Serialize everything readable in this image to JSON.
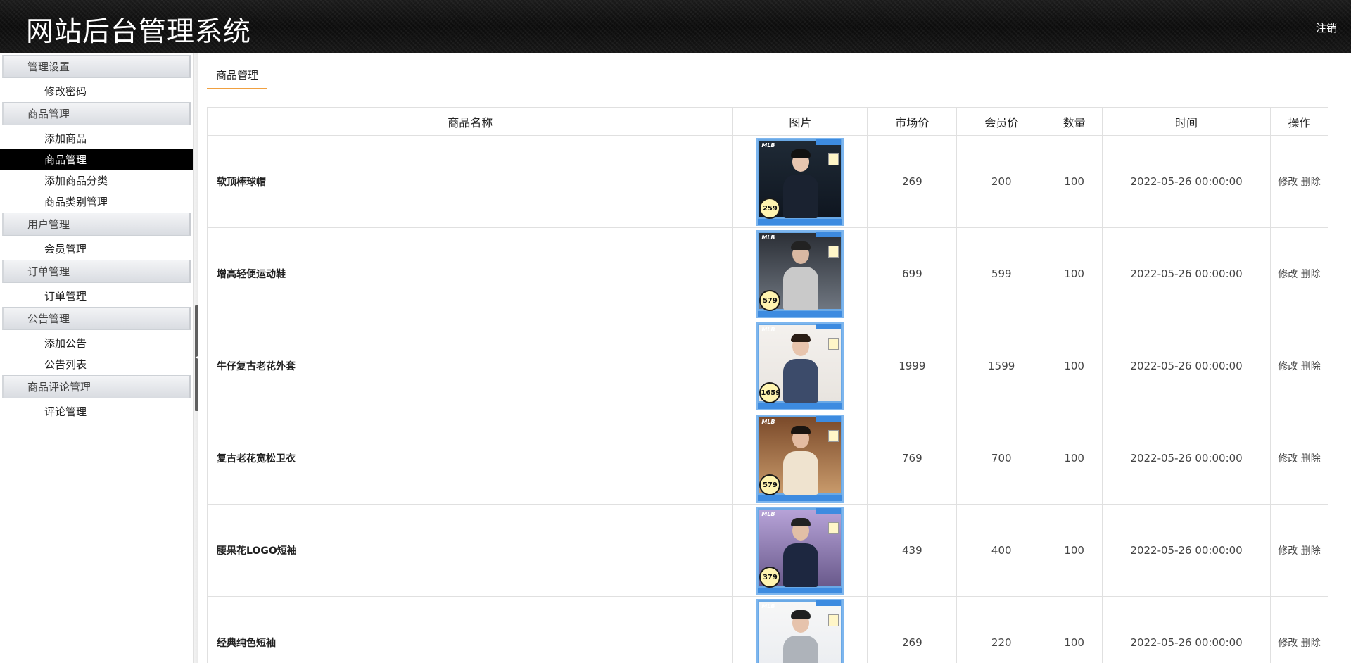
{
  "header": {
    "title": "网站后台管理系统",
    "logout": "注销"
  },
  "sidebar": {
    "groups": [
      {
        "title": "管理设置",
        "items": [
          "修改密码"
        ]
      },
      {
        "title": "商品管理",
        "items": [
          "添加商品",
          "商品管理",
          "添加商品分类",
          "商品类别管理"
        ]
      },
      {
        "title": "用户管理",
        "items": [
          "会员管理"
        ]
      },
      {
        "title": "订单管理",
        "items": [
          "订单管理"
        ]
      },
      {
        "title": "公告管理",
        "items": [
          "添加公告",
          "公告列表"
        ]
      },
      {
        "title": "商品评论管理",
        "items": [
          "评论管理"
        ]
      }
    ],
    "active_item": "商品管理"
  },
  "tab": {
    "label": "商品管理"
  },
  "table": {
    "columns": [
      "商品名称",
      "图片",
      "市场价",
      "会员价",
      "数量",
      "时间",
      "操作"
    ],
    "edit_label": "修改",
    "delete_label": "删除",
    "rows": [
      {
        "name": "软顶棒球帽",
        "market_price": "269",
        "member_price": "200",
        "quantity": "100",
        "time": "2022-05-26 00:00:00",
        "image": {
          "brand": "MLB",
          "badge": "259",
          "theme": "dark"
        }
      },
      {
        "name": "增高轻便运动鞋",
        "market_price": "699",
        "member_price": "599",
        "quantity": "100",
        "time": "2022-05-26 00:00:00",
        "image": {
          "brand": "MLB",
          "badge": "579",
          "theme": "grey"
        }
      },
      {
        "name": "牛仔复古老花外套",
        "market_price": "1999",
        "member_price": "1599",
        "quantity": "100",
        "time": "2022-05-26 00:00:00",
        "image": {
          "brand": "MLB",
          "badge": "1659",
          "theme": "light"
        }
      },
      {
        "name": "复古老花宽松卫衣",
        "market_price": "769",
        "member_price": "700",
        "quantity": "100",
        "time": "2022-05-26 00:00:00",
        "image": {
          "brand": "MLB",
          "badge": "579",
          "theme": "brown"
        }
      },
      {
        "name": "腰果花LOGO短袖",
        "market_price": "439",
        "member_price": "400",
        "quantity": "100",
        "time": "2022-05-26 00:00:00",
        "image": {
          "brand": "MLB",
          "badge": "379",
          "theme": "purple"
        }
      },
      {
        "name": "经典纯色短袖",
        "market_price": "269",
        "member_price": "220",
        "quantity": "100",
        "time": "2022-05-26 00:00:00",
        "image": {
          "brand": "MLB",
          "badge": "",
          "theme": "white"
        }
      }
    ]
  }
}
